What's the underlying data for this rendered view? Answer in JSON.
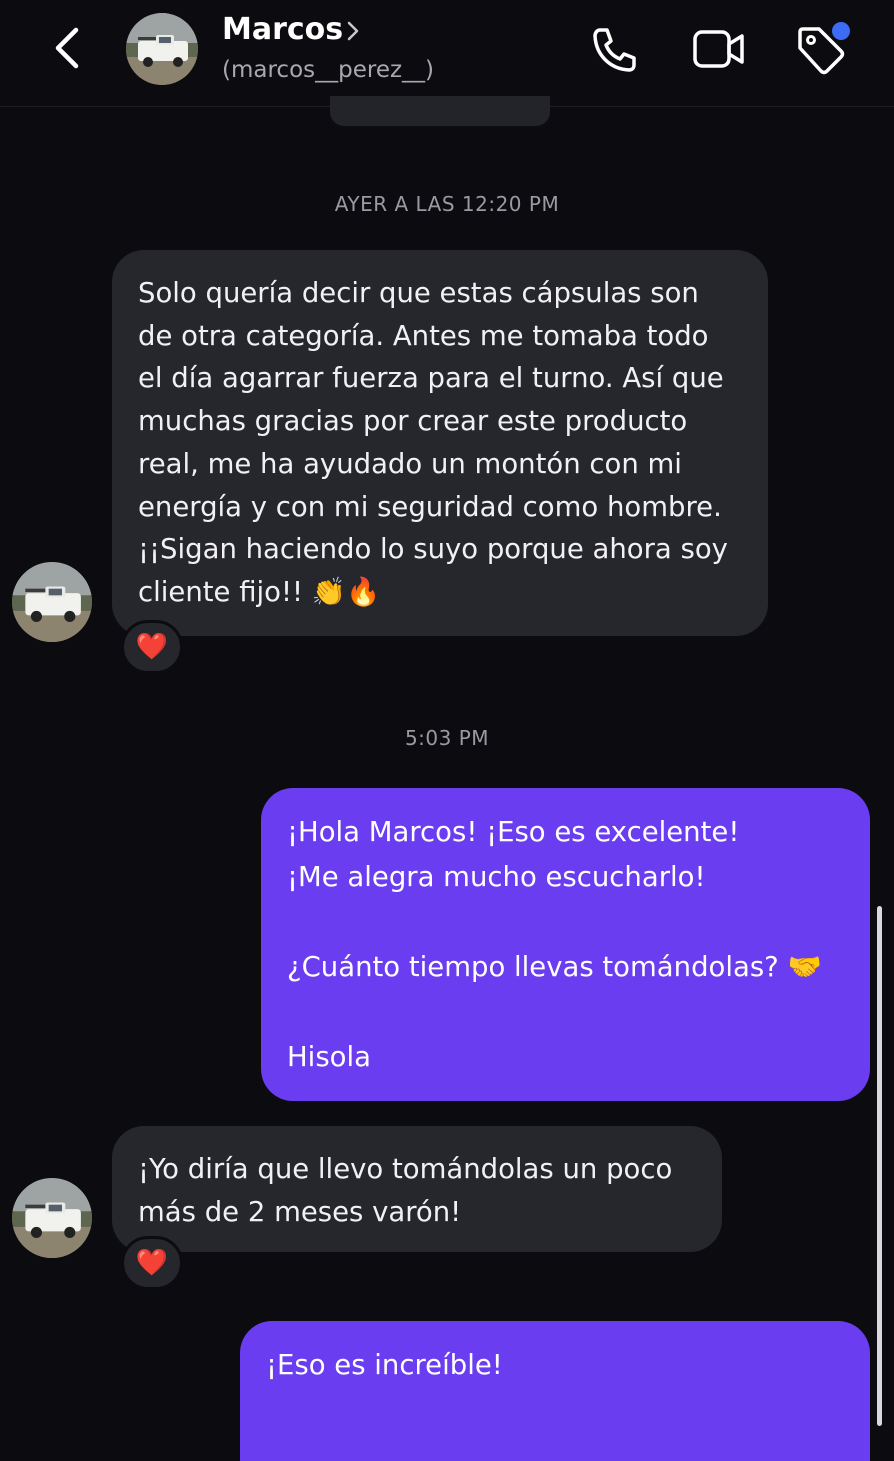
{
  "header": {
    "contact_name": "Marcos",
    "contact_handle": "(marcos__perez__)",
    "icons": {
      "back": "chevron-left-icon",
      "name_chevron": "chevron-right-icon",
      "call": "phone-icon",
      "video": "video-camera-icon",
      "tag": "tag-icon"
    },
    "notification_dot_color": "#3c6cf5"
  },
  "messages": {
    "timestamp_1": "AYER A LAS 12:20 PM",
    "msg_1": "Solo quería decir que estas cápsulas son\nde otra categoría. Antes me tomaba todo\nel día agarrar fuerza para el turno. Así que\nmuchas gracias por crear este producto\nreal, me ha ayudado un montón con mi\nenergía y con mi seguridad como hombre.\n¡¡Sigan haciendo lo suyo porque ahora soy\ncliente fijo!! 👏🔥",
    "msg_1_reaction": "❤️",
    "timestamp_2": "5:03 PM",
    "msg_2": "¡Hola Marcos! ¡Eso es excelente!\n¡Me alegra mucho escucharlo!\n\n¿Cuánto tiempo llevas tomándolas? 🤝\n\nHisola",
    "msg_3": "¡Yo diría que llevo tomándolas un poco\nmás de 2 meses varón!",
    "msg_3_reaction": "❤️",
    "msg_4": "¡Eso es increíble!"
  },
  "colors": {
    "background": "#0b0b10",
    "incoming_bubble": "#26262d",
    "outgoing_bubble": "#6b3df0"
  }
}
